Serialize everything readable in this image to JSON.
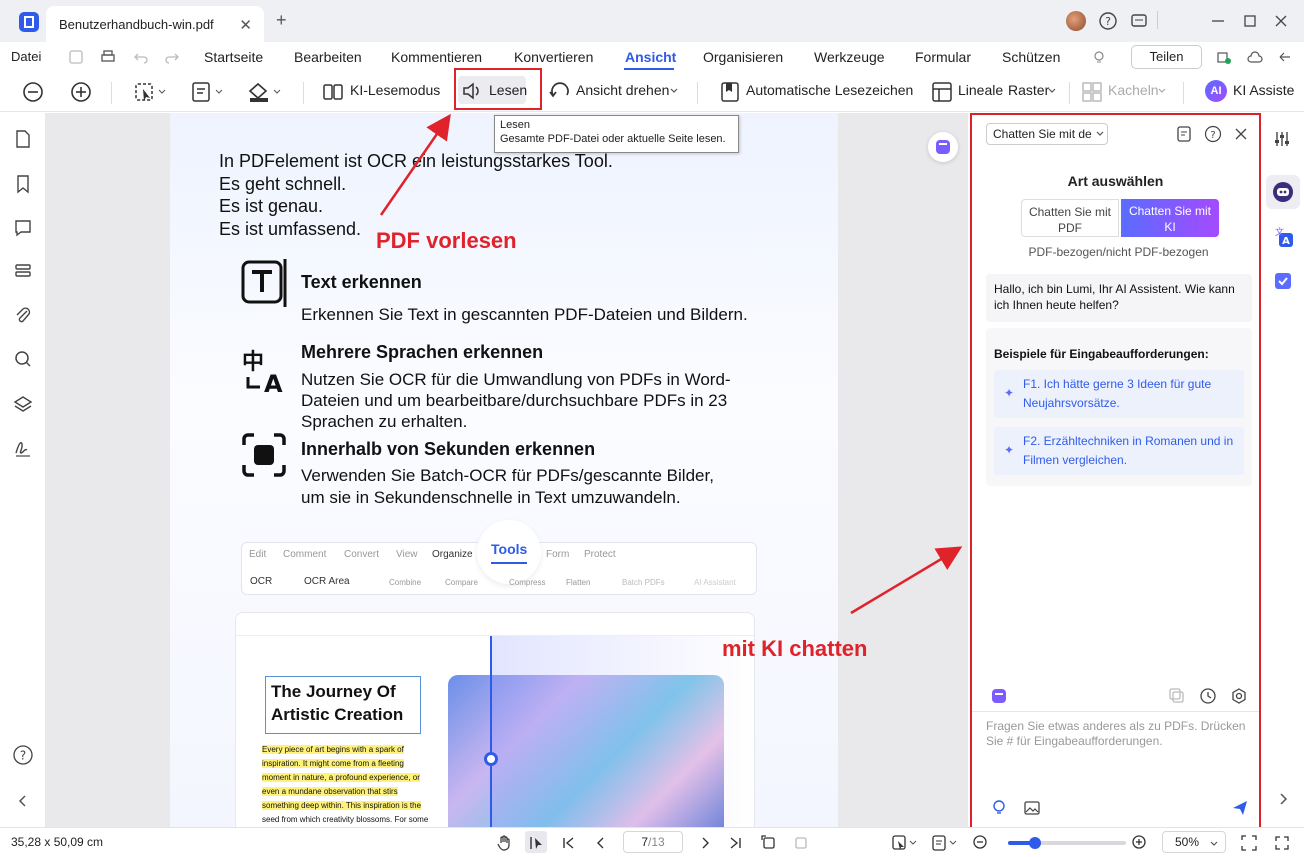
{
  "titlebar": {
    "tab_title": "Benutzerhandbuch-win.pdf"
  },
  "menu": {
    "file": "Datei",
    "items": [
      "Startseite",
      "Bearbeiten",
      "Kommentieren",
      "Konvertieren",
      "Ansicht",
      "Organisieren",
      "Werkzeuge",
      "Formular",
      "Schützen"
    ],
    "active": "Ansicht",
    "share": "Teilen"
  },
  "toolbar": {
    "reading_mode": "KI-Lesemodus",
    "read": "Lesen",
    "rotate": "Ansicht drehen",
    "auto_bookmarks": "Automatische Lesezeichen",
    "rulers": "Lineale",
    "grid": "Raster",
    "tiles": "Kacheln",
    "ai_assistant": "KI Assiste"
  },
  "tooltip": {
    "title": "Lesen",
    "desc": "Gesamte PDF-Datei oder aktuelle Seite lesen."
  },
  "annotations": {
    "read_pdf": "PDF vorlesen",
    "chat_ai": "mit KI chatten"
  },
  "document": {
    "intro": [
      "In PDFelement ist OCR ein leistungsstarkes Tool.",
      "Es geht schnell.",
      "Es ist genau.",
      "Es ist umfassend."
    ],
    "features": [
      {
        "title": "Text erkennen",
        "body": [
          "Erkennen Sie Text in gescannten PDF-Dateien und Bildern."
        ]
      },
      {
        "title": "Mehrere Sprachen erkennen",
        "body": [
          "Nutzen Sie OCR für die Umwandlung von PDFs in Word-",
          "Dateien und um bearbeitbare/durchsuchbare PDFs in 23",
          "Sprachen zu erhalten."
        ]
      },
      {
        "title": "Innerhalb von Sekunden erkennen",
        "body": [
          "Verwenden Sie Batch-OCR für PDFs/gescannte Bilder,",
          "um sie in Sekundenschnelle in Text umzuwandeln."
        ]
      }
    ],
    "mock_tabs": [
      "Edit",
      "Comment",
      "Convert",
      "View",
      "Organize",
      "Tools",
      "Form",
      "Protect"
    ],
    "mock_tools": [
      "OCR",
      "OCR Area",
      "Combine",
      "Compare",
      "Compress",
      "Flatten",
      "Batch PDFs",
      "AI Assistant"
    ],
    "journey_title": [
      "The Journey Of",
      "Artistic Creation"
    ],
    "journey_text": [
      "Every piece of art begins with a spark of",
      "inspiration. It might come from a fleeting",
      "moment in nature, a profound experience, or",
      "even a mundane observation that stirs",
      "something deep within. This inspiration is the",
      "seed from which creativity blossoms. For some"
    ]
  },
  "ai": {
    "mode_select": "Chatten Sie mit de",
    "heading": "Art auswählen",
    "opt_pdf": [
      "Chatten Sie mit",
      "PDF"
    ],
    "opt_ai": [
      "Chatten Sie mit",
      "KI"
    ],
    "subtitle": "PDF-bezogen/nicht PDF-bezogen",
    "greeting": "Hallo, ich bin Lumi, Ihr AI Assistent. Wie kann ich Ihnen heute helfen?",
    "examples_title": "Beispiele für Eingabeaufforderungen:",
    "examples": [
      "F1. Ich hätte gerne 3 Ideen für gute Neujahrsvorsätze.",
      "F2. Erzähltechniken in Romanen und in Filmen vergleichen."
    ],
    "input_placeholder": "Fragen Sie etwas anderes als zu PDFs. Drücken Sie # für Eingabeaufforderungen."
  },
  "status": {
    "dimensions": "35,28 x 50,09 cm",
    "page_current": "7",
    "page_total": "/13",
    "zoom": "50%",
    "zoom_level": 0.5
  },
  "colors": {
    "accent": "#2f5bea",
    "annotation": "#e0222a",
    "ai_gradient": [
      "#5b6cff",
      "#a44bff"
    ]
  }
}
